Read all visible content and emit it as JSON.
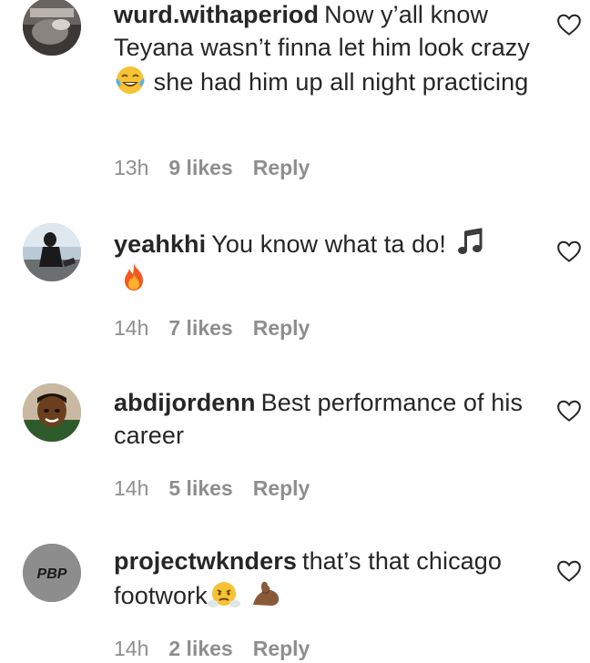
{
  "comments": [
    {
      "username": "wurd.withaperiod",
      "text_parts": [
        "Now y’all know Teyana wasn’t finna let him look crazy",
        "she had him up all night practicing"
      ],
      "emojis": [
        "face-with-tears-of-joy"
      ],
      "time": "13h",
      "likes": "9 likes",
      "reply": "Reply"
    },
    {
      "username": "yeahkhi",
      "text_parts": [
        "You know what ta do!",
        ""
      ],
      "emojis": [
        "musical-note",
        "fire"
      ],
      "time": "14h",
      "likes": "7 likes",
      "reply": "Reply"
    },
    {
      "username": "abdijordenn",
      "text_parts": [
        "Best performance of his career"
      ],
      "emojis": [],
      "time": "14h",
      "likes": "5 likes",
      "reply": "Reply"
    },
    {
      "username": "projectwknders",
      "text_parts": [
        "that’s that chicago footwork",
        ""
      ],
      "emojis": [
        "face-with-steam-from-nose",
        "flexed-biceps-medium-dark-skin"
      ],
      "avatar_text": "PBP",
      "time": "14h",
      "likes": "2 likes",
      "reply": "Reply"
    }
  ],
  "colors": {
    "text": "#262626",
    "meta": "#8e8e8e",
    "heart_outline": "#262626"
  }
}
